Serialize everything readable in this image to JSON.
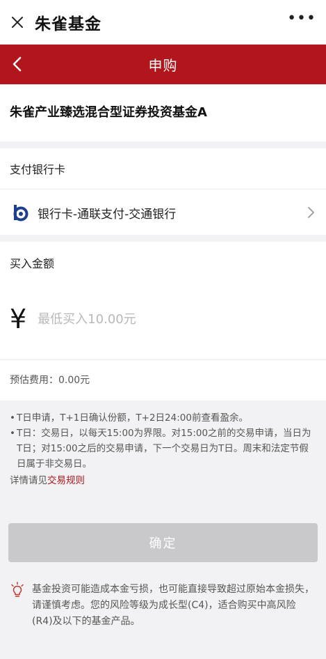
{
  "window": {
    "title": "朱雀基金",
    "more_icon": "more-dots-icon",
    "close_icon": "close-icon"
  },
  "header": {
    "title": "申购",
    "back_icon": "chevron-left-icon"
  },
  "fund": {
    "name": "朱雀产业臻选混合型证券投资基金A"
  },
  "payment": {
    "label": "支付银行卡",
    "bank_text": "银行卡-通联支付-交通银行",
    "bank_icon": "bank-of-communications-logo",
    "chevron_icon": "chevron-right-icon"
  },
  "amount": {
    "label": "买入金额",
    "currency_symbol": "¥",
    "placeholder": "最低买入10.00元",
    "value": ""
  },
  "fee": {
    "text": "预估费用：0.00元"
  },
  "notes": {
    "items": [
      "T日申请，T+1日确认份额，T+2日24:00前查看盈余。",
      "T日：交易日，以每天15:00为界限。对15:00之前的交易申请，当日为T日；对15:00之后的交易申请，下一个交易日为T日。周末和法定节假日属于非交易日。"
    ],
    "detail_prefix": "详情请见",
    "detail_link": "交易规则"
  },
  "confirm": {
    "label": "确定"
  },
  "risk": {
    "icon": "lightbulb-icon",
    "text": "基金投资可能造成本金亏损，也可能直接导致超过原始本金损失，请谨慎考虑。您的风险等级为成长型(C4)，适合购买中高风险(R4)及以下的基金产品。"
  },
  "colors": {
    "brand_red": "#b0161c",
    "disabled_button": "#c9c9cc",
    "background": "#f2f2f4"
  }
}
